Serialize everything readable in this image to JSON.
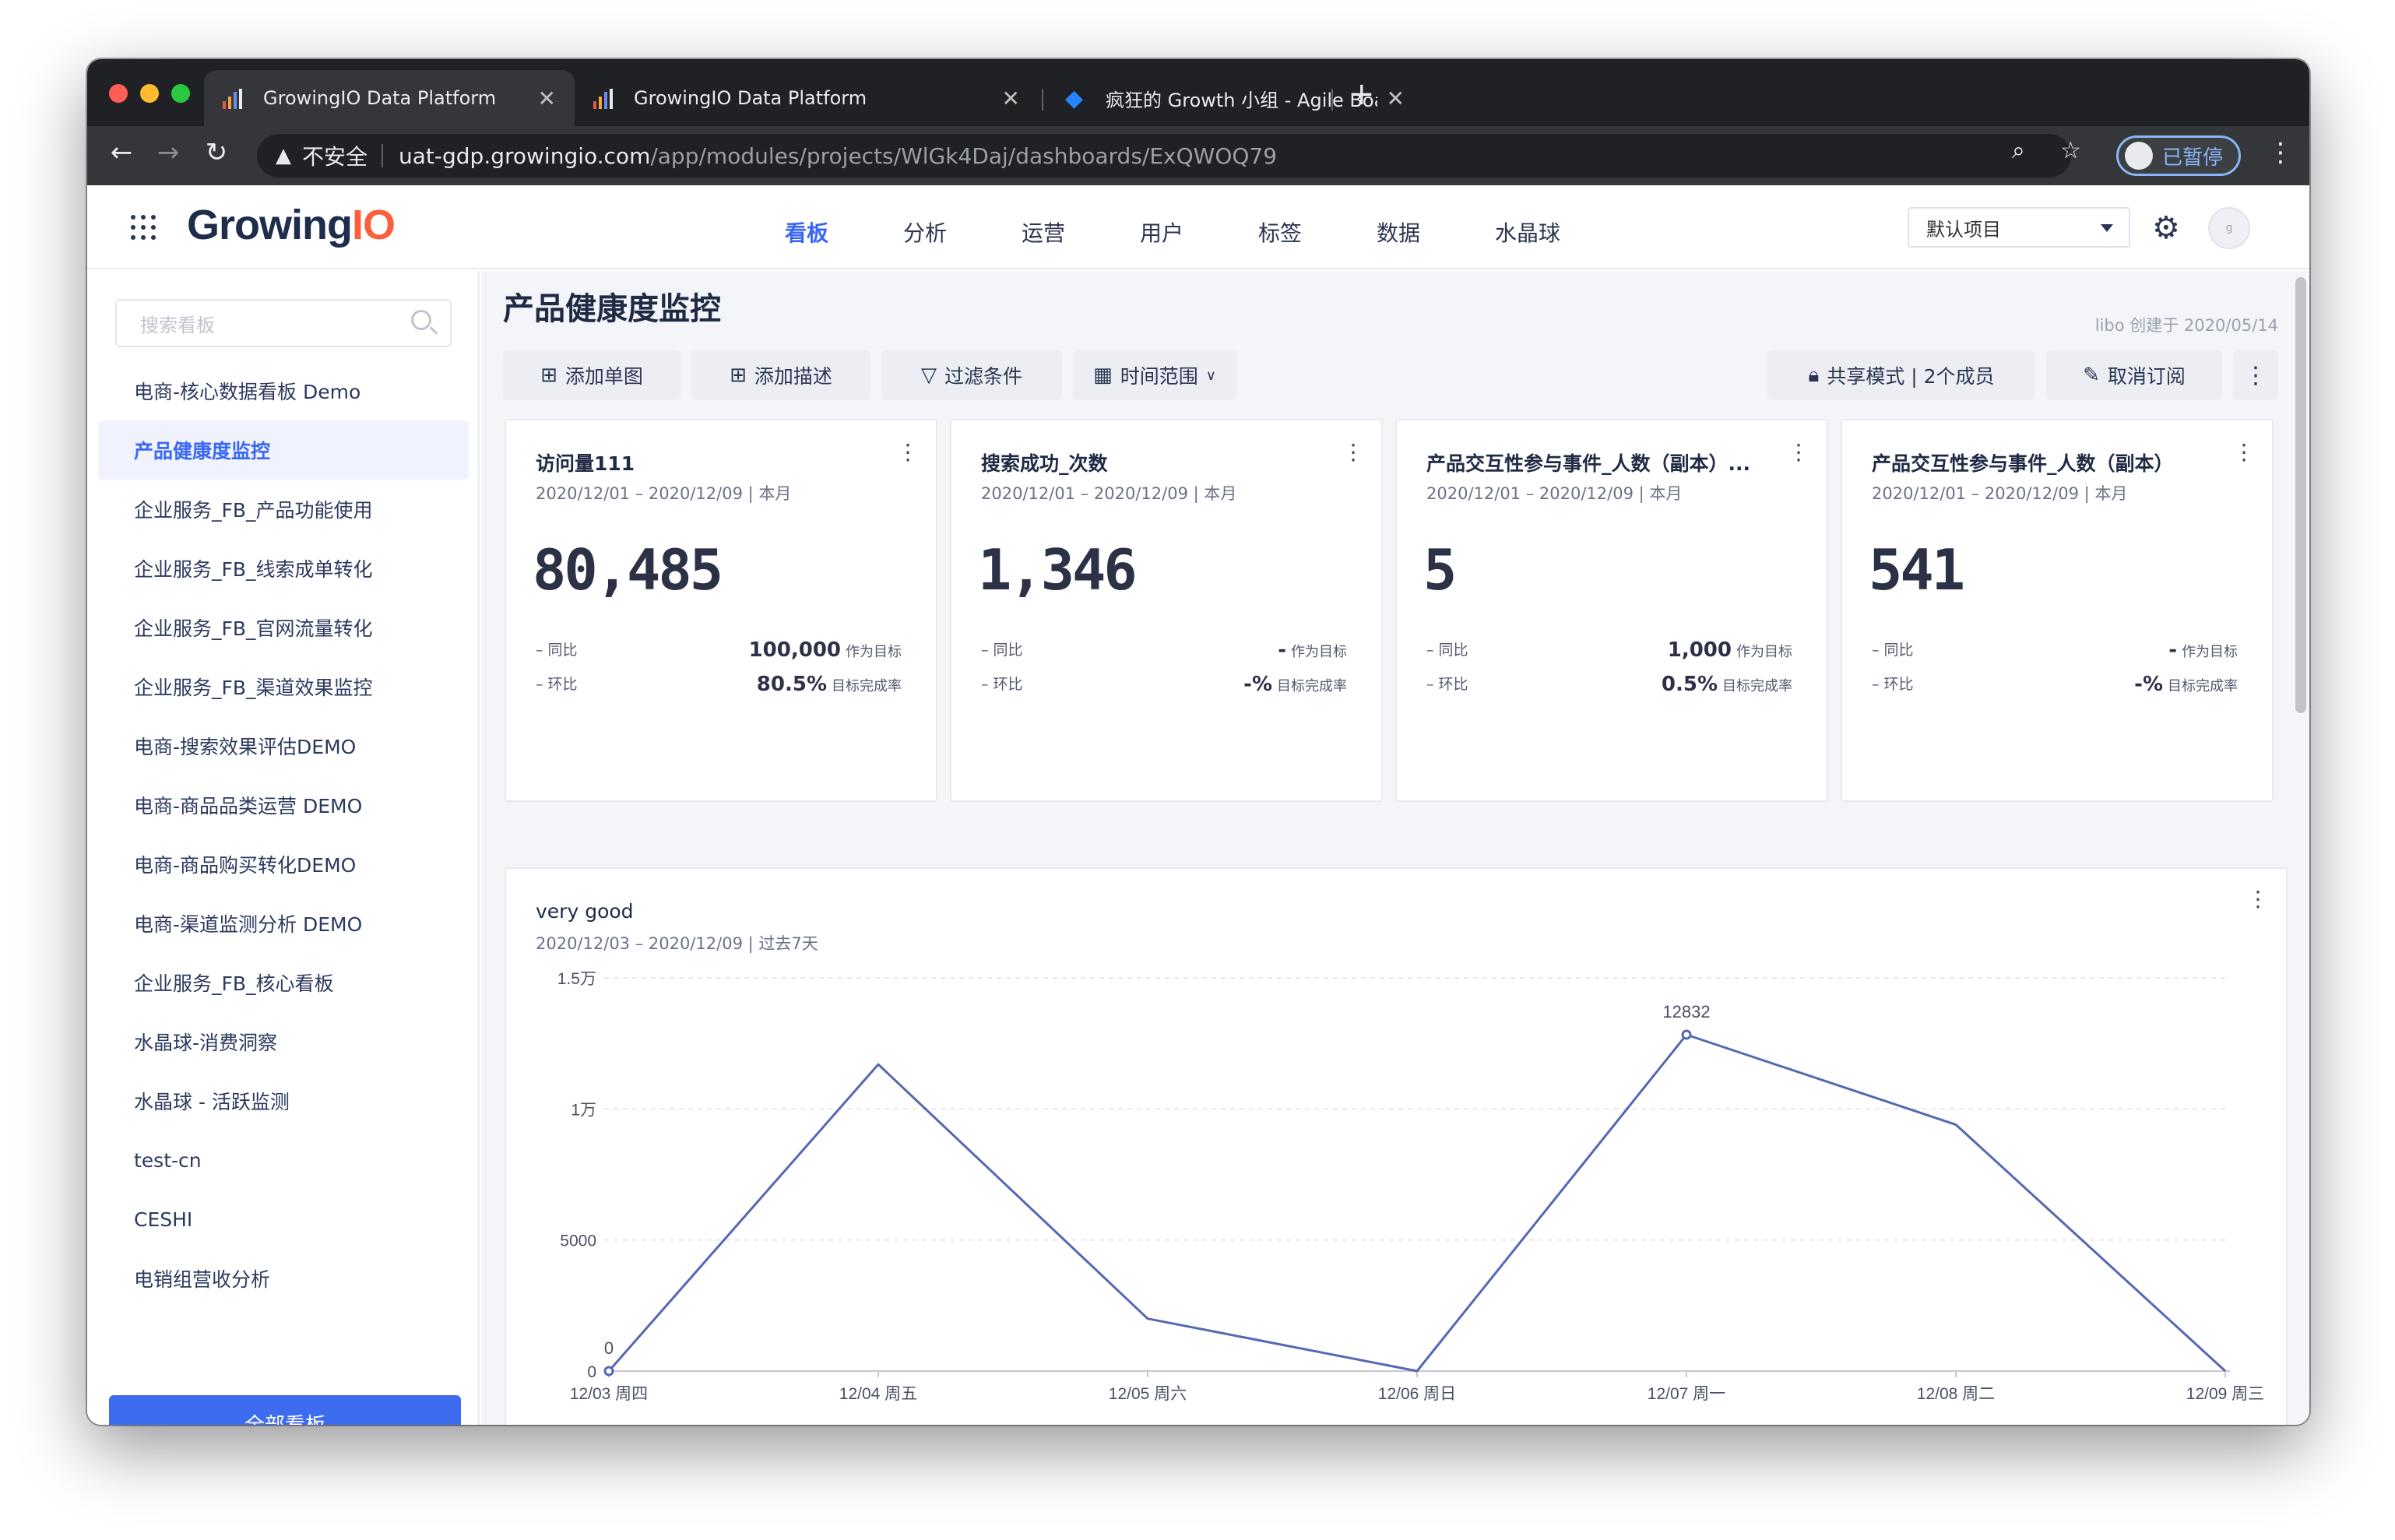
{
  "browser": {
    "tabs": [
      {
        "title": "GrowingIO Data Platform",
        "active": true
      },
      {
        "title": "GrowingIO Data Platform",
        "active": false
      },
      {
        "title": "疯狂的 Growth 小组 - Agile Boa",
        "active": false
      }
    ],
    "insecure_label": "不安全",
    "url_host": "uat-gdp.growingio.com",
    "url_path": "/app/modules/projects/WlGk4Daj/dashboards/ExQWOQ79",
    "profile_label": "已暂停"
  },
  "app": {
    "logo_main": "Growing",
    "logo_accent": "IO",
    "brand_color": "#3867f4",
    "nav": [
      "看板",
      "分析",
      "运营",
      "用户",
      "标签",
      "数据",
      "水晶球"
    ],
    "project_select": "默认项目",
    "avatar_initial": "g"
  },
  "sidebar": {
    "search_placeholder": "搜索看板",
    "items": [
      {
        "label": "电商-核心数据看板 Demo",
        "active": false
      },
      {
        "label": "产品健康度监控",
        "active": true
      },
      {
        "label": "企业服务_FB_产品功能使用",
        "active": false
      },
      {
        "label": "企业服务_FB_线索成单转化",
        "active": false
      },
      {
        "label": "企业服务_FB_官网流量转化",
        "active": false
      },
      {
        "label": "企业服务_FB_渠道效果监控",
        "active": false
      },
      {
        "label": "电商-搜索效果评估DEMO",
        "active": false
      },
      {
        "label": "电商-商品品类运营 DEMO",
        "active": false
      },
      {
        "label": "电商-商品购买转化DEMO",
        "active": false
      },
      {
        "label": "电商-渠道监测分析 DEMO",
        "active": false
      },
      {
        "label": "企业服务_FB_核心看板",
        "active": false
      },
      {
        "label": "水晶球-消费洞察",
        "active": false
      },
      {
        "label": "水晶球 - 活跃监测",
        "active": false
      },
      {
        "label": "test-cn",
        "active": false
      },
      {
        "label": "CESHI",
        "active": false
      },
      {
        "label": "电销组营收分析",
        "active": false
      }
    ],
    "all_boards_button": "全部看板"
  },
  "dashboard": {
    "title": "产品健康度监控",
    "creator": "libo 创建于 2020/05/14",
    "actions": {
      "add_chart": "添加单图",
      "add_desc": "添加描述",
      "filter": "过滤条件",
      "time_range": "时间范围",
      "share": "共享模式 | 2个成员",
      "unsubscribe": "取消订阅"
    },
    "kpi_cards": [
      {
        "title": "访问量111",
        "subtitle": "2020/12/01 – 2020/12/09 | 本月",
        "value": "80,485",
        "yoy_label": "– 同比",
        "mom_label": "– 环比",
        "target_value": "100,000",
        "target_label": "作为目标",
        "completion_value": "80.5%",
        "completion_label": "目标完成率"
      },
      {
        "title": "搜索成功_次数",
        "subtitle": "2020/12/01 – 2020/12/09 | 本月",
        "value": "1,346",
        "yoy_label": "– 同比",
        "mom_label": "– 环比",
        "target_value": "-",
        "target_label": "作为目标",
        "completion_value": "-%",
        "completion_label": "目标完成率"
      },
      {
        "title": "产品交互性参与事件_人数（副本）...",
        "subtitle": "2020/12/01 – 2020/12/09 | 本月",
        "value": "5",
        "yoy_label": "– 同比",
        "mom_label": "– 环比",
        "target_value": "1,000",
        "target_label": "作为目标",
        "completion_value": "0.5%",
        "completion_label": "目标完成率"
      },
      {
        "title": "产品交互性参与事件_人数（副本）",
        "subtitle": "2020/12/01 – 2020/12/09 | 本月",
        "value": "541",
        "yoy_label": "– 同比",
        "mom_label": "– 环比",
        "target_value": "-",
        "target_label": "作为目标",
        "completion_value": "-%",
        "completion_label": "目标完成率"
      }
    ],
    "line_card": {
      "title": "very good",
      "subtitle": "2020/12/03 – 2020/12/09 | 过去7天"
    }
  },
  "chart_data": {
    "type": "line",
    "title": "very good",
    "categories": [
      "12/03 周四",
      "12/04 周五",
      "12/05 周六",
      "12/06 周日",
      "12/07 周一",
      "12/08 周二",
      "12/09 周三"
    ],
    "series": [
      {
        "values": [
          0,
          11700,
          2000,
          0,
          12832,
          9400,
          0
        ],
        "color": "#5468b3"
      }
    ],
    "y_ticks": [
      {
        "value": 0,
        "label": "0"
      },
      {
        "value": 5000,
        "label": "5000"
      },
      {
        "value": 10000,
        "label": "1万"
      },
      {
        "value": 15000,
        "label": "1.5万"
      }
    ],
    "ylim": [
      0,
      15000
    ],
    "data_labels": [
      {
        "index": 0,
        "text": "0"
      },
      {
        "index": 4,
        "text": "12832"
      }
    ],
    "grid": true
  }
}
